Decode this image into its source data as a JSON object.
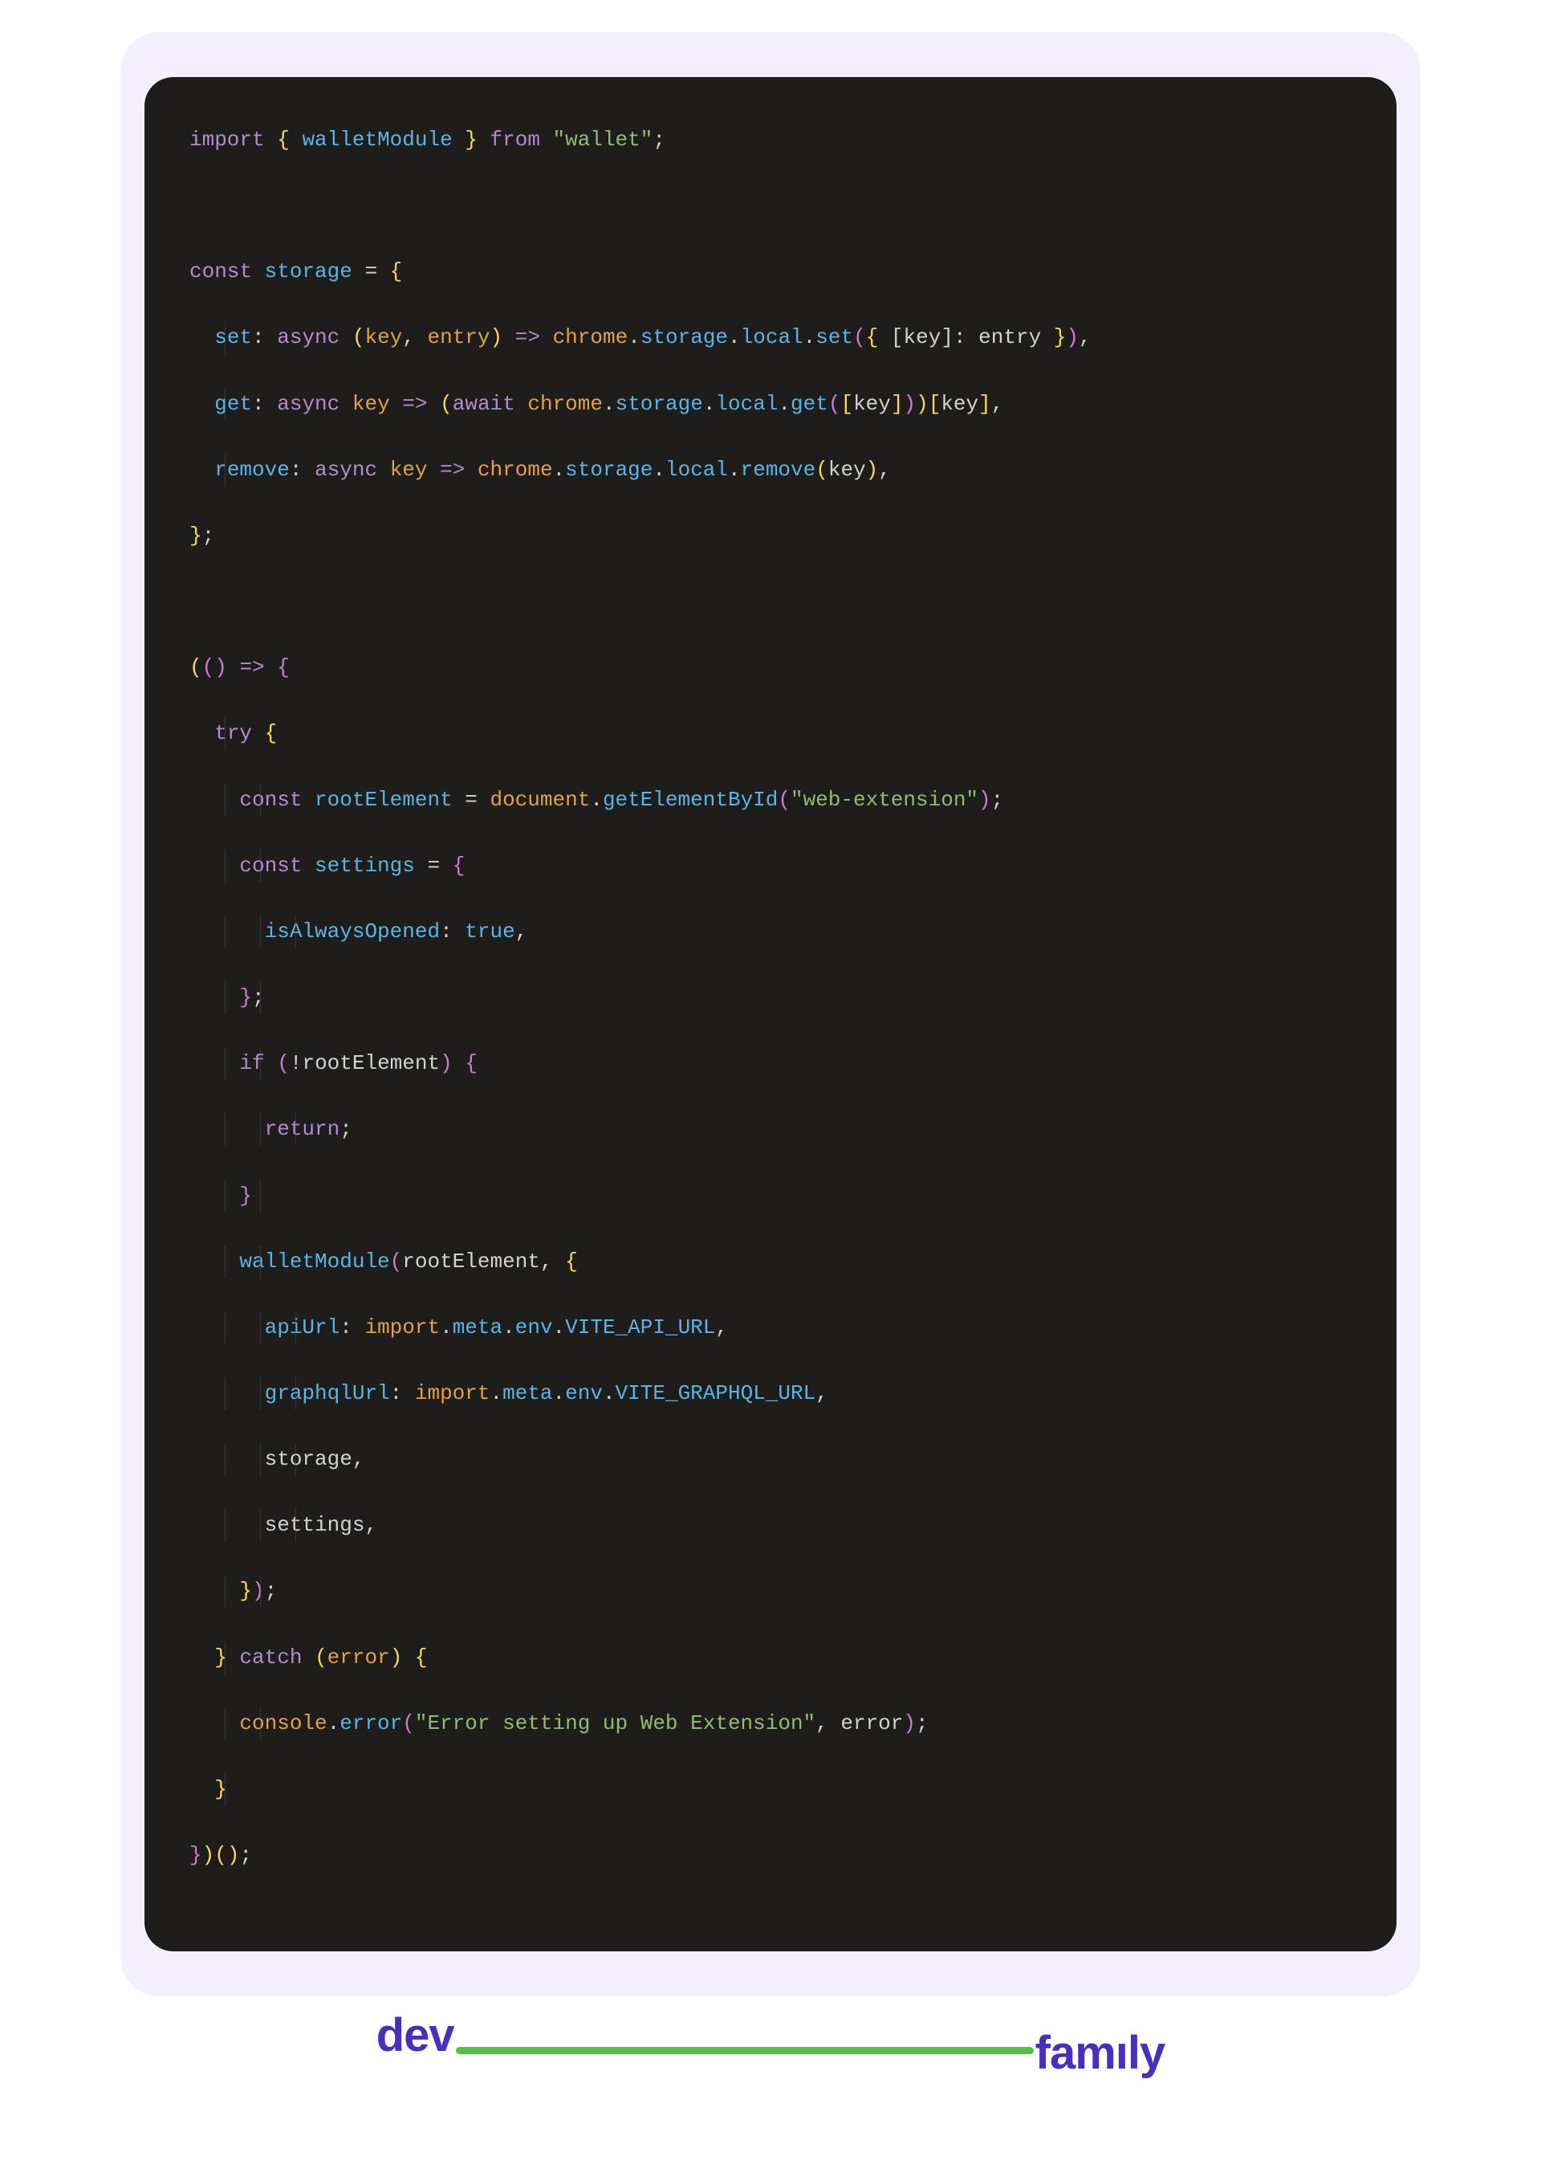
{
  "logo": {
    "left": "dev",
    "right": "famıly"
  },
  "code": {
    "lines": [
      {
        "guides": [],
        "tokens": [
          {
            "t": "import",
            "c": "tk-key"
          },
          {
            "t": " ",
            "c": ""
          },
          {
            "t": "{ ",
            "c": "tk-brace"
          },
          {
            "t": "walletModule",
            "c": "tk-var"
          },
          {
            "t": " }",
            "c": "tk-brace"
          },
          {
            "t": " ",
            "c": ""
          },
          {
            "t": "from",
            "c": "tk-key"
          },
          {
            "t": " ",
            "c": ""
          },
          {
            "t": "\"wallet\"",
            "c": "tk-str"
          },
          {
            "t": ";",
            "c": "tk-pun"
          }
        ]
      },
      {
        "guides": [],
        "tokens": [
          {
            "t": " ",
            "c": ""
          }
        ]
      },
      {
        "guides": [],
        "tokens": [
          {
            "t": "const",
            "c": "tk-key"
          },
          {
            "t": " ",
            "c": ""
          },
          {
            "t": "storage",
            "c": "tk-var"
          },
          {
            "t": " = ",
            "c": "tk-op"
          },
          {
            "t": "{",
            "c": "tk-brace"
          }
        ]
      },
      {
        "guides": [
          1
        ],
        "tokens": [
          {
            "t": "  ",
            "c": ""
          },
          {
            "t": "set",
            "c": "tk-prop"
          },
          {
            "t": ": ",
            "c": "tk-pun"
          },
          {
            "t": "async",
            "c": "tk-key"
          },
          {
            "t": " ",
            "c": ""
          },
          {
            "t": "(",
            "c": "tk-brace"
          },
          {
            "t": "key",
            "c": "tk-param"
          },
          {
            "t": ", ",
            "c": "tk-pun"
          },
          {
            "t": "entry",
            "c": "tk-param"
          },
          {
            "t": ")",
            "c": "tk-brace"
          },
          {
            "t": " ",
            "c": ""
          },
          {
            "t": "=>",
            "c": "tk-key"
          },
          {
            "t": " ",
            "c": ""
          },
          {
            "t": "chrome",
            "c": "tk-obj"
          },
          {
            "t": ".",
            "c": "tk-pun"
          },
          {
            "t": "storage",
            "c": "tk-mem"
          },
          {
            "t": ".",
            "c": "tk-pun"
          },
          {
            "t": "local",
            "c": "tk-mem"
          },
          {
            "t": ".",
            "c": "tk-pun"
          },
          {
            "t": "set",
            "c": "tk-fn"
          },
          {
            "t": "(",
            "c": "tk-brace2"
          },
          {
            "t": "{ ",
            "c": "tk-brace"
          },
          {
            "t": "[",
            "c": "tk-pun"
          },
          {
            "t": "key",
            "c": "tk-id"
          },
          {
            "t": "]",
            "c": "tk-pun"
          },
          {
            "t": ": ",
            "c": "tk-pun"
          },
          {
            "t": "entry",
            "c": "tk-id"
          },
          {
            "t": " }",
            "c": "tk-brace"
          },
          {
            "t": ")",
            "c": "tk-brace2"
          },
          {
            "t": ",",
            "c": "tk-pun"
          }
        ]
      },
      {
        "guides": [
          1
        ],
        "tokens": [
          {
            "t": "  ",
            "c": ""
          },
          {
            "t": "get",
            "c": "tk-prop"
          },
          {
            "t": ": ",
            "c": "tk-pun"
          },
          {
            "t": "async",
            "c": "tk-key"
          },
          {
            "t": " ",
            "c": ""
          },
          {
            "t": "key",
            "c": "tk-param"
          },
          {
            "t": " ",
            "c": ""
          },
          {
            "t": "=>",
            "c": "tk-key"
          },
          {
            "t": " ",
            "c": ""
          },
          {
            "t": "(",
            "c": "tk-brace"
          },
          {
            "t": "await",
            "c": "tk-await"
          },
          {
            "t": " ",
            "c": ""
          },
          {
            "t": "chrome",
            "c": "tk-obj"
          },
          {
            "t": ".",
            "c": "tk-pun"
          },
          {
            "t": "storage",
            "c": "tk-mem"
          },
          {
            "t": ".",
            "c": "tk-pun"
          },
          {
            "t": "local",
            "c": "tk-mem"
          },
          {
            "t": ".",
            "c": "tk-pun"
          },
          {
            "t": "get",
            "c": "tk-fn"
          },
          {
            "t": "(",
            "c": "tk-brace2"
          },
          {
            "t": "[",
            "c": "tk-brace"
          },
          {
            "t": "key",
            "c": "tk-id"
          },
          {
            "t": "]",
            "c": "tk-brace"
          },
          {
            "t": ")",
            "c": "tk-brace2"
          },
          {
            "t": ")",
            "c": "tk-brace"
          },
          {
            "t": "[",
            "c": "tk-brace"
          },
          {
            "t": "key",
            "c": "tk-id"
          },
          {
            "t": "]",
            "c": "tk-brace"
          },
          {
            "t": ",",
            "c": "tk-pun"
          }
        ]
      },
      {
        "guides": [
          1
        ],
        "tokens": [
          {
            "t": "  ",
            "c": ""
          },
          {
            "t": "remove",
            "c": "tk-prop"
          },
          {
            "t": ": ",
            "c": "tk-pun"
          },
          {
            "t": "async",
            "c": "tk-key"
          },
          {
            "t": " ",
            "c": ""
          },
          {
            "t": "key",
            "c": "tk-param"
          },
          {
            "t": " ",
            "c": ""
          },
          {
            "t": "=>",
            "c": "tk-key"
          },
          {
            "t": " ",
            "c": ""
          },
          {
            "t": "chrome",
            "c": "tk-obj"
          },
          {
            "t": ".",
            "c": "tk-pun"
          },
          {
            "t": "storage",
            "c": "tk-mem"
          },
          {
            "t": ".",
            "c": "tk-pun"
          },
          {
            "t": "local",
            "c": "tk-mem"
          },
          {
            "t": ".",
            "c": "tk-pun"
          },
          {
            "t": "remove",
            "c": "tk-fn"
          },
          {
            "t": "(",
            "c": "tk-brace"
          },
          {
            "t": "key",
            "c": "tk-id"
          },
          {
            "t": ")",
            "c": "tk-brace"
          },
          {
            "t": ",",
            "c": "tk-pun"
          }
        ]
      },
      {
        "guides": [],
        "tokens": [
          {
            "t": "}",
            "c": "tk-brace"
          },
          {
            "t": ";",
            "c": "tk-pun"
          }
        ]
      },
      {
        "guides": [],
        "tokens": [
          {
            "t": " ",
            "c": ""
          }
        ]
      },
      {
        "guides": [],
        "tokens": [
          {
            "t": "(",
            "c": "tk-brace"
          },
          {
            "t": "(",
            "c": "tk-brace2"
          },
          {
            "t": ")",
            "c": "tk-brace2"
          },
          {
            "t": " ",
            "c": ""
          },
          {
            "t": "=>",
            "c": "tk-key"
          },
          {
            "t": " ",
            "c": ""
          },
          {
            "t": "{",
            "c": "tk-brace2"
          }
        ]
      },
      {
        "guides": [
          1
        ],
        "tokens": [
          {
            "t": "  ",
            "c": ""
          },
          {
            "t": "try",
            "c": "tk-key"
          },
          {
            "t": " ",
            "c": ""
          },
          {
            "t": "{",
            "c": "tk-brace"
          }
        ]
      },
      {
        "guides": [
          1,
          2
        ],
        "tokens": [
          {
            "t": "    ",
            "c": ""
          },
          {
            "t": "const",
            "c": "tk-key"
          },
          {
            "t": " ",
            "c": ""
          },
          {
            "t": "rootElement",
            "c": "tk-var"
          },
          {
            "t": " = ",
            "c": "tk-op"
          },
          {
            "t": "document",
            "c": "tk-obj"
          },
          {
            "t": ".",
            "c": "tk-pun"
          },
          {
            "t": "getElementById",
            "c": "tk-fn"
          },
          {
            "t": "(",
            "c": "tk-brace2"
          },
          {
            "t": "\"web-extension\"",
            "c": "tk-str"
          },
          {
            "t": ")",
            "c": "tk-brace2"
          },
          {
            "t": ";",
            "c": "tk-pun"
          }
        ]
      },
      {
        "guides": [
          1,
          2
        ],
        "tokens": [
          {
            "t": "    ",
            "c": ""
          },
          {
            "t": "const",
            "c": "tk-key"
          },
          {
            "t": " ",
            "c": ""
          },
          {
            "t": "settings",
            "c": "tk-var"
          },
          {
            "t": " = ",
            "c": "tk-op"
          },
          {
            "t": "{",
            "c": "tk-brace2"
          }
        ]
      },
      {
        "guides": [
          1,
          2,
          3
        ],
        "tokens": [
          {
            "t": "      ",
            "c": ""
          },
          {
            "t": "isAlwaysOpened",
            "c": "tk-prop"
          },
          {
            "t": ": ",
            "c": "tk-pun"
          },
          {
            "t": "true",
            "c": "tk-bool"
          },
          {
            "t": ",",
            "c": "tk-pun"
          }
        ]
      },
      {
        "guides": [
          1,
          2
        ],
        "tokens": [
          {
            "t": "    ",
            "c": ""
          },
          {
            "t": "}",
            "c": "tk-brace2"
          },
          {
            "t": ";",
            "c": "tk-pun"
          }
        ]
      },
      {
        "guides": [
          1,
          2
        ],
        "tokens": [
          {
            "t": "    ",
            "c": ""
          },
          {
            "t": "if",
            "c": "tk-key"
          },
          {
            "t": " ",
            "c": ""
          },
          {
            "t": "(",
            "c": "tk-brace2"
          },
          {
            "t": "!",
            "c": "tk-neg"
          },
          {
            "t": "rootElement",
            "c": "tk-id"
          },
          {
            "t": ")",
            "c": "tk-brace2"
          },
          {
            "t": " ",
            "c": ""
          },
          {
            "t": "{",
            "c": "tk-brace2"
          }
        ]
      },
      {
        "guides": [
          1,
          2,
          3
        ],
        "tokens": [
          {
            "t": "      ",
            "c": ""
          },
          {
            "t": "return",
            "c": "tk-key"
          },
          {
            "t": ";",
            "c": "tk-pun"
          }
        ]
      },
      {
        "guides": [
          1,
          2
        ],
        "tokens": [
          {
            "t": "    ",
            "c": ""
          },
          {
            "t": "}",
            "c": "tk-brace2"
          }
        ]
      },
      {
        "guides": [
          1,
          2
        ],
        "tokens": [
          {
            "t": "    ",
            "c": ""
          },
          {
            "t": "walletModule",
            "c": "tk-fn"
          },
          {
            "t": "(",
            "c": "tk-brace2"
          },
          {
            "t": "rootElement",
            "c": "tk-id"
          },
          {
            "t": ", ",
            "c": "tk-pun"
          },
          {
            "t": "{",
            "c": "tk-brace"
          }
        ]
      },
      {
        "guides": [
          1,
          2,
          3
        ],
        "tokens": [
          {
            "t": "      ",
            "c": ""
          },
          {
            "t": "apiUrl",
            "c": "tk-prop"
          },
          {
            "t": ": ",
            "c": "tk-pun"
          },
          {
            "t": "import",
            "c": "tk-obj"
          },
          {
            "t": ".",
            "c": "tk-pun"
          },
          {
            "t": "meta",
            "c": "tk-mem"
          },
          {
            "t": ".",
            "c": "tk-pun"
          },
          {
            "t": "env",
            "c": "tk-mem"
          },
          {
            "t": ".",
            "c": "tk-pun"
          },
          {
            "t": "VITE_API_URL",
            "c": "tk-mem"
          },
          {
            "t": ",",
            "c": "tk-pun"
          }
        ]
      },
      {
        "guides": [
          1,
          2,
          3
        ],
        "tokens": [
          {
            "t": "      ",
            "c": ""
          },
          {
            "t": "graphqlUrl",
            "c": "tk-prop"
          },
          {
            "t": ": ",
            "c": "tk-pun"
          },
          {
            "t": "import",
            "c": "tk-obj"
          },
          {
            "t": ".",
            "c": "tk-pun"
          },
          {
            "t": "meta",
            "c": "tk-mem"
          },
          {
            "t": ".",
            "c": "tk-pun"
          },
          {
            "t": "env",
            "c": "tk-mem"
          },
          {
            "t": ".",
            "c": "tk-pun"
          },
          {
            "t": "VITE_GRAPHQL_URL",
            "c": "tk-mem"
          },
          {
            "t": ",",
            "c": "tk-pun"
          }
        ]
      },
      {
        "guides": [
          1,
          2,
          3
        ],
        "tokens": [
          {
            "t": "      ",
            "c": ""
          },
          {
            "t": "storage",
            "c": "tk-id"
          },
          {
            "t": ",",
            "c": "tk-pun"
          }
        ]
      },
      {
        "guides": [
          1,
          2,
          3
        ],
        "tokens": [
          {
            "t": "      ",
            "c": ""
          },
          {
            "t": "settings",
            "c": "tk-id"
          },
          {
            "t": ",",
            "c": "tk-pun"
          }
        ]
      },
      {
        "guides": [
          1,
          2
        ],
        "tokens": [
          {
            "t": "    ",
            "c": ""
          },
          {
            "t": "}",
            "c": "tk-brace"
          },
          {
            "t": ")",
            "c": "tk-brace2"
          },
          {
            "t": ";",
            "c": "tk-pun"
          }
        ]
      },
      {
        "guides": [
          1
        ],
        "tokens": [
          {
            "t": "  ",
            "c": ""
          },
          {
            "t": "}",
            "c": "tk-brace"
          },
          {
            "t": " ",
            "c": ""
          },
          {
            "t": "catch",
            "c": "tk-key"
          },
          {
            "t": " ",
            "c": ""
          },
          {
            "t": "(",
            "c": "tk-brace"
          },
          {
            "t": "error",
            "c": "tk-param"
          },
          {
            "t": ")",
            "c": "tk-brace"
          },
          {
            "t": " ",
            "c": ""
          },
          {
            "t": "{",
            "c": "tk-brace"
          }
        ]
      },
      {
        "guides": [
          1,
          2
        ],
        "tokens": [
          {
            "t": "    ",
            "c": ""
          },
          {
            "t": "console",
            "c": "tk-obj"
          },
          {
            "t": ".",
            "c": "tk-pun"
          },
          {
            "t": "error",
            "c": "tk-fn"
          },
          {
            "t": "(",
            "c": "tk-brace2"
          },
          {
            "t": "\"Error setting up Web Extension\"",
            "c": "tk-str"
          },
          {
            "t": ", ",
            "c": "tk-pun"
          },
          {
            "t": "error",
            "c": "tk-id"
          },
          {
            "t": ")",
            "c": "tk-brace2"
          },
          {
            "t": ";",
            "c": "tk-pun"
          }
        ]
      },
      {
        "guides": [
          1
        ],
        "tokens": [
          {
            "t": "  ",
            "c": ""
          },
          {
            "t": "}",
            "c": "tk-brace"
          }
        ]
      },
      {
        "guides": [],
        "tokens": [
          {
            "t": "}",
            "c": "tk-brace2"
          },
          {
            "t": ")",
            "c": "tk-brace"
          },
          {
            "t": "(",
            "c": "tk-brace"
          },
          {
            "t": ")",
            "c": "tk-brace"
          },
          {
            "t": ";",
            "c": "tk-pun"
          }
        ]
      }
    ]
  }
}
